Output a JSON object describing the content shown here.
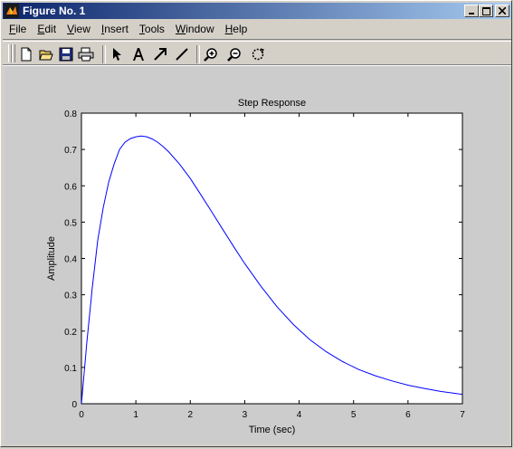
{
  "window": {
    "title": "Figure No. 1",
    "controls": [
      "minimize",
      "maximize",
      "close"
    ]
  },
  "menu": [
    "File",
    "Edit",
    "View",
    "Insert",
    "Tools",
    "Window",
    "Help"
  ],
  "toolbar": {
    "tools": [
      {
        "name": "new-figure",
        "icon": "new-document-icon"
      },
      {
        "name": "open-file",
        "icon": "open-folder-icon"
      },
      {
        "name": "save",
        "icon": "floppy-disk-icon"
      },
      {
        "name": "print",
        "icon": "printer-icon"
      },
      {
        "name": "edit-plot",
        "icon": "arrow-pointer-icon"
      },
      {
        "name": "insert-text",
        "icon": "text-a-icon"
      },
      {
        "name": "insert-arrow",
        "icon": "arrow-icon"
      },
      {
        "name": "insert-line",
        "icon": "line-icon"
      },
      {
        "name": "zoom-in",
        "icon": "zoom-in-icon"
      },
      {
        "name": "zoom-out",
        "icon": "zoom-out-icon"
      },
      {
        "name": "rotate-3d",
        "icon": "rotate-icon"
      }
    ]
  },
  "colors": {
    "title_gradient_start": "#0a246a",
    "title_gradient_end": "#a6caf0",
    "figure_background": "#cccccc",
    "axes_background": "#ffffff",
    "line": "#0000ff"
  },
  "chart_data": {
    "type": "line",
    "title": "Step Response",
    "xlabel": "Time (sec)",
    "ylabel": "Amplitude",
    "xlim": [
      0,
      7
    ],
    "ylim": [
      0,
      0.8
    ],
    "xticks": [
      0,
      1,
      2,
      3,
      4,
      5,
      6,
      7
    ],
    "xtick_labels": [
      "0",
      "1",
      "2",
      "3",
      "4",
      "5",
      "6",
      "7"
    ],
    "yticks": [
      0,
      0.1,
      0.2,
      0.3,
      0.4,
      0.5,
      0.6,
      0.7,
      0.8
    ],
    "ytick_labels": [
      "0",
      "0.1",
      "0.2",
      "0.3",
      "0.4",
      "0.5",
      "0.6",
      "0.7",
      "0.8"
    ],
    "grid": false,
    "series": [
      {
        "color": "#0000ff",
        "x": [
          0,
          0.1,
          0.2,
          0.3,
          0.4,
          0.5,
          0.6,
          0.7,
          0.8,
          0.9,
          1.0,
          1.1,
          1.2,
          1.3,
          1.4,
          1.5,
          1.6,
          1.8,
          2.0,
          2.2,
          2.4,
          2.6,
          2.8,
          3.0,
          3.3,
          3.6,
          3.9,
          4.2,
          4.5,
          4.8,
          5.1,
          5.4,
          5.7,
          6.0,
          6.3,
          6.6,
          7.0
        ],
        "y": [
          0,
          0.17,
          0.32,
          0.45,
          0.54,
          0.61,
          0.66,
          0.7,
          0.72,
          0.73,
          0.735,
          0.737,
          0.735,
          0.729,
          0.72,
          0.708,
          0.694,
          0.66,
          0.62,
          0.574,
          0.527,
          0.479,
          0.432,
          0.386,
          0.323,
          0.266,
          0.217,
          0.176,
          0.143,
          0.116,
          0.094,
          0.077,
          0.063,
          0.051,
          0.042,
          0.034,
          0.026
        ]
      },
      {
        "color": "#000000",
        "dashed": true,
        "x": [
          0,
          7
        ],
        "y": [
          0,
          0
        ]
      }
    ]
  }
}
